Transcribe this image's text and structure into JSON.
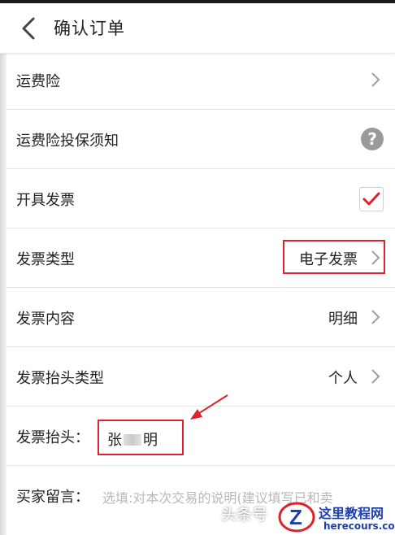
{
  "header": {
    "title": "确认订单"
  },
  "rows": {
    "shipping_insurance": {
      "label": "运费险"
    },
    "insurance_notice": {
      "label": "运费险投保须知"
    },
    "issue_invoice": {
      "label": "开具发票",
      "checked": true
    },
    "invoice_type": {
      "label": "发票类型",
      "value": "电子发票"
    },
    "invoice_content": {
      "label": "发票内容",
      "value": "明细"
    },
    "invoice_title_type": {
      "label": "发票抬头类型",
      "value": "个人"
    },
    "invoice_title": {
      "label": "发票抬头：",
      "value_start": "张",
      "value_end": "明"
    },
    "buyer_message": {
      "label": "买家留言：",
      "placeholder": "选填:对本次交易的说明(建议填写已和卖"
    }
  },
  "watermark": {
    "source": "头条号",
    "site_cn": "这里教程网",
    "site_en": "herecours.com"
  },
  "colors": {
    "accent_red": "#e0202a",
    "watermark_blue": "#1d3fb0"
  }
}
